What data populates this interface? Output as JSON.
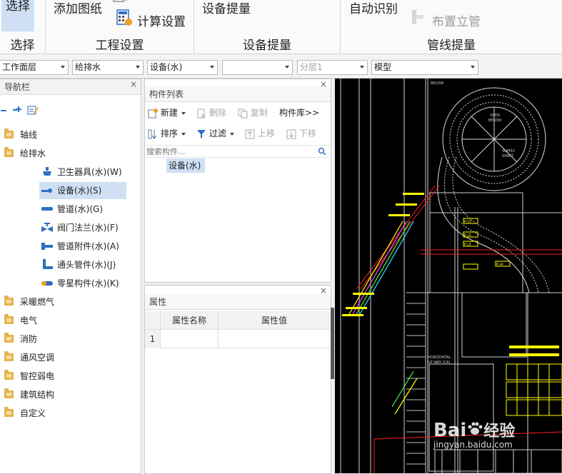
{
  "ribbon": {
    "groups": [
      {
        "label": "选择",
        "buttons": [
          {
            "label": "选择"
          }
        ]
      },
      {
        "label": "工程设置",
        "buttons": [
          {
            "label": "添加图纸"
          },
          {
            "label": "计算设置"
          }
        ]
      },
      {
        "label": "设备提量",
        "buttons": [
          {
            "label": "设备提量"
          }
        ]
      },
      {
        "label": "管线提量",
        "buttons": [
          {
            "label": "自动识别"
          },
          {
            "label": "布置立管"
          }
        ]
      }
    ]
  },
  "dropdowns": [
    {
      "value": "工作面层"
    },
    {
      "value": "给排水"
    },
    {
      "value": "设备(水)"
    },
    {
      "value": ""
    },
    {
      "value": "分层1"
    },
    {
      "value": "模型"
    }
  ],
  "nav": {
    "title": "导航栏",
    "close": "×",
    "items": [
      {
        "label": "轴线"
      },
      {
        "label": "给排水"
      },
      {
        "label": "卫生器具(水)(W)"
      },
      {
        "label": "设备(水)(S)"
      },
      {
        "label": "管道(水)(G)"
      },
      {
        "label": "阀门法兰(水)(F)"
      },
      {
        "label": "管道附件(水)(A)"
      },
      {
        "label": "通头管件(水)(J)"
      },
      {
        "label": "零星构件(水)(K)"
      },
      {
        "label": "采暖燃气"
      },
      {
        "label": "电气"
      },
      {
        "label": "消防"
      },
      {
        "label": "通风空调"
      },
      {
        "label": "智控弱电"
      },
      {
        "label": "建筑结构"
      },
      {
        "label": "自定义"
      }
    ]
  },
  "component_list": {
    "title": "构件列表",
    "close": "×",
    "new": "新建",
    "delete": "删除",
    "copy": "复制",
    "library": "构件库>>",
    "sort": "排序",
    "filter": "过滤",
    "move_up": "上移",
    "move_down": "下移",
    "search_placeholder": "搜索构件...",
    "items": [
      "设备(水)"
    ]
  },
  "properties": {
    "title": "属性",
    "close": "×",
    "col_name": "属性名称",
    "col_value": "属性值",
    "rows": [
      {
        "index": "1",
        "name": "",
        "value": ""
      }
    ]
  },
  "cad": {
    "labels": [
      "OPEN",
      "BELOW",
      "SUPPLY",
      "SHAFT",
      "BELOW",
      "P-J3",
      "P-J3",
      "P-J3",
      "P-J4",
      "HORIZONTAL",
      "UP WAY [CA]"
    ]
  },
  "watermark": {
    "brand": "Bai",
    "brand2": "经验",
    "url": "jingyan.baidu.com"
  },
  "colors": {
    "selection": "#cfe0f5",
    "folder": "#e7b24f",
    "accent_blue": "#2f6fbf",
    "cad_bg": "#000000"
  }
}
